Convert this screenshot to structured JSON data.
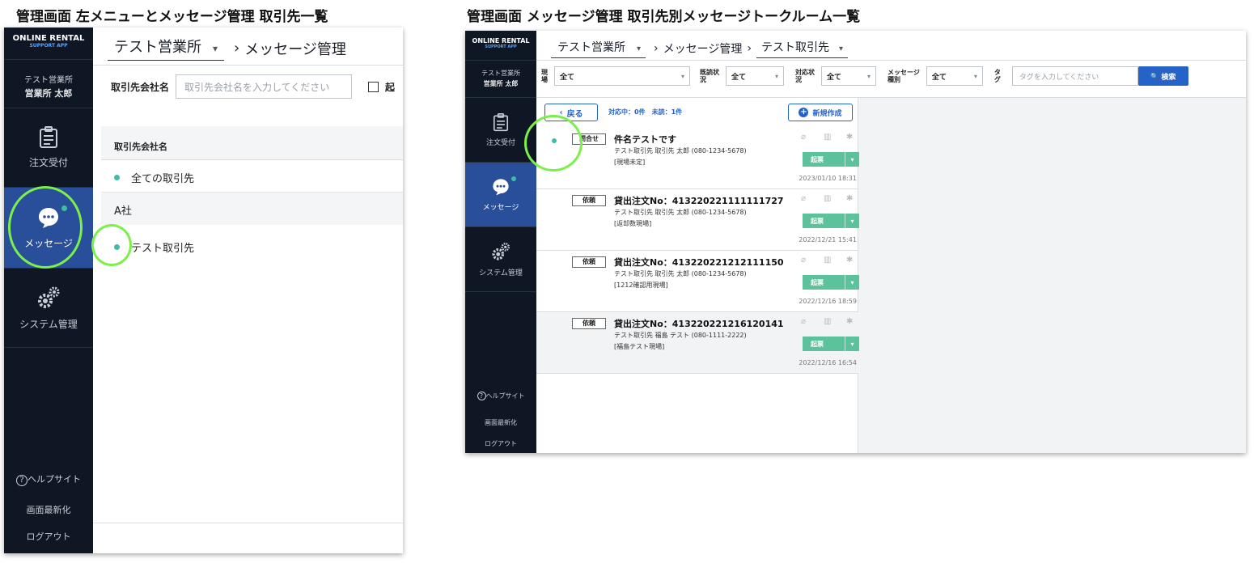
{
  "captions": {
    "left": "管理画面 左メニューとメッセージ管理 取引先一覧",
    "right": "管理画面 メッセージ管理 取引先別メッセージトークルーム一覧"
  },
  "colors": {
    "sidebar": "#0f1724",
    "nav_active": "#2a4f9a",
    "logo_sub": "#5aa2ff",
    "unread_dot": "#3dbca9",
    "highlight": "#7cf04a",
    "ticket": "#5bc29c",
    "search_button": "#2563c9"
  },
  "sidebar": {
    "logo_line1": "ONLINE RENTAL",
    "logo_line2": "SUPPORT APP",
    "user_office": "テスト営業所",
    "user_name": "営業所 太郎",
    "nav": [
      {
        "label": "注文受付",
        "icon": "clipboard-icon",
        "active": false
      },
      {
        "label": "メッセージ",
        "icon": "chat-bubble-icon",
        "active": true
      },
      {
        "label": "システム管理",
        "icon": "gears-icon",
        "active": false
      }
    ],
    "help_mark": "?",
    "help": "ヘルプサイト",
    "refresh": "画面最新化",
    "logout": "ログアウト"
  },
  "left_screen": {
    "breadcrumb": {
      "office": "テスト営業所",
      "dropdown": "▾",
      "page": "メッセージ管理",
      "sep": "›"
    },
    "filter": {
      "label": "取引先会社名",
      "placeholder": "取引先会社名を入力してください",
      "checkbox_label": "起"
    },
    "table": {
      "header": "取引先会社名",
      "rows": [
        {
          "text": "全ての取引先",
          "dot": true
        },
        {
          "text": "A社",
          "dot": false
        },
        {
          "text": "テスト取引先",
          "dot": true
        }
      ]
    }
  },
  "right_screen": {
    "breadcrumb": {
      "office": "テスト営業所",
      "page": "メッセージ管理",
      "client": "テスト取引先",
      "dropdown": "▾",
      "sep": "›"
    },
    "filters": {
      "site_label": "現\n場",
      "site_value": "全て",
      "read_label": "既読状\n況",
      "read_value": "全て",
      "status_label": "対応状\n況",
      "status_value": "全て",
      "type_label": "メッセージ\n種別",
      "type_value": "全て",
      "tag_label": "タ\nグ",
      "tag_placeholder": "タグを入力してください",
      "search_icon": "🔍",
      "search_label": "検索"
    },
    "list_head": {
      "back": "戻る",
      "status": "対応中：0件　未読：1件",
      "new": "新規作成"
    },
    "items": [
      {
        "tag": "問合せ",
        "title": "件名テストです",
        "client": "テスト取引先 取引先 太郎 (080-1234-5678)",
        "site": "[現場未定]",
        "date": "2023/01/10 18:31",
        "ticket": "起票",
        "unread": true
      },
      {
        "tag": "依頼",
        "title": "貸出注文No：413220221111111727",
        "client": "テスト取引先 取引先 太郎 (080-1234-5678)",
        "site": "[返却数現場]",
        "date": "2022/12/21 15:41",
        "ticket": "起票",
        "unread": false
      },
      {
        "tag": "依頼",
        "title": "貸出注文No：413220221212111150",
        "client": "テスト取引先 取引先 太郎 (080-1234-5678)",
        "site": "[1212確認用現場]",
        "date": "2022/12/16 18:59",
        "ticket": "起票",
        "unread": false
      },
      {
        "tag": "依頼",
        "title": "貸出注文No：413220221216120141",
        "client": "テスト取引先 福島 テスト (080-1111-2222)",
        "site": "[福島テスト現場]",
        "date": "2022/12/16 16:54",
        "ticket": "起票",
        "unread": false
      }
    ]
  }
}
